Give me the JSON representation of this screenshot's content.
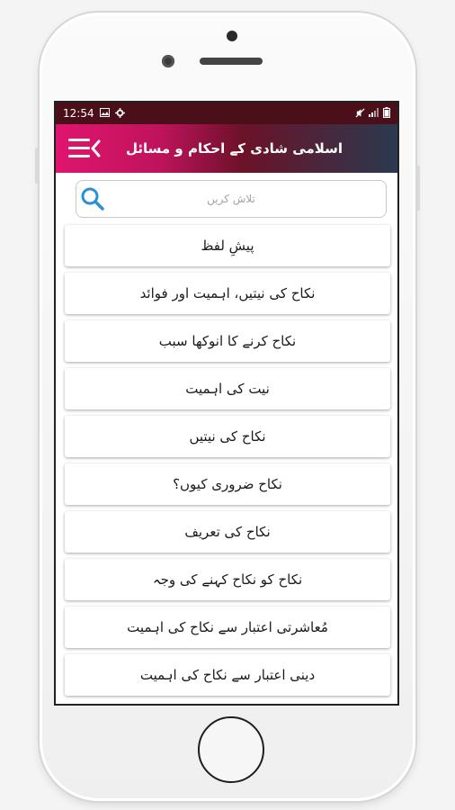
{
  "status_bar": {
    "time": "12:54",
    "icons": [
      "image-icon",
      "settings-icon",
      "mute-icon",
      "signal-icon",
      "battery-icon"
    ]
  },
  "app_bar": {
    "title": "اسلامی شادی کے احکام و مسائل",
    "menu_icon": "menu-back-icon",
    "gradient": [
      "#e0156f",
      "#6b1228",
      "#2a3a4f"
    ]
  },
  "search": {
    "placeholder": "تلاش کریں",
    "icon": "search-icon",
    "icon_color": "#2b8fd6"
  },
  "items": [
    {
      "label": "پیشِ لفظ"
    },
    {
      "label": "نکاح کی نیتیں، اہمیت اور فوائد"
    },
    {
      "label": "نکاح کرنے کا انوکھا سبب"
    },
    {
      "label": "نیت کی اہمیت"
    },
    {
      "label": "نکاح کی نیتیں"
    },
    {
      "label": "نکاح ضروری کیوں؟"
    },
    {
      "label": "نکاح کی تعریف"
    },
    {
      "label": "نکاح کو نکاح کہنے کی وجہ"
    },
    {
      "label": "مُعاشرتی اعتبار سے نکاح کی اہمیت"
    },
    {
      "label": "دینی اعتبار سے نکاح کی اہمیت"
    }
  ]
}
